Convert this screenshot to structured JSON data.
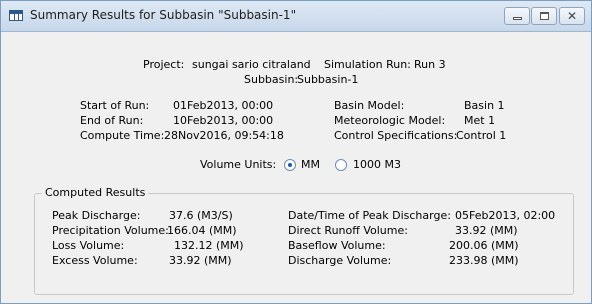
{
  "window": {
    "title": "Summary Results for Subbasin \"Subbasin-1\"",
    "icon": "table-window-icon"
  },
  "header": {
    "project_label": "Project:",
    "project_value": "sungai sario citraland",
    "run_label": "Simulation Run:",
    "run_value": "Run 3",
    "subbasin_label": "Subbasin:",
    "subbasin_value": "Subbasin-1"
  },
  "run_info": {
    "start_label": "Start of Run:",
    "start_value": "01Feb2013, 00:00",
    "end_label": "End of Run:",
    "end_value": "10Feb2013, 00:00",
    "compute_label": "Compute Time:",
    "compute_value": "28Nov2016, 09:54:18",
    "basin_label": "Basin Model:",
    "basin_value": "Basin 1",
    "met_label": "Meteorologic Model:",
    "met_value": "Met 1",
    "control_label": "Control Specifications:",
    "control_value": "Control 1"
  },
  "volume_units": {
    "label": "Volume Units:",
    "options": [
      "MM",
      "1000 M3"
    ],
    "selected": "MM"
  },
  "computed_results": {
    "title": "Computed Results",
    "left": [
      {
        "label": "Peak Discharge:",
        "value": "37.6 (M3/S)"
      },
      {
        "label": "Precipitation Volume:",
        "value": "166.04 (MM)"
      },
      {
        "label": "Loss Volume:",
        "value": "132.12 (MM)"
      },
      {
        "label": "Excess Volume:",
        "value": "33.92 (MM)"
      }
    ],
    "right": [
      {
        "label": "Date/Time of Peak Discharge:",
        "value": "05Feb2013, 02:00"
      },
      {
        "label": "Direct Runoff Volume:",
        "value": "33.92 (MM)"
      },
      {
        "label": "Baseflow Volume:",
        "value": "200.06 (MM)"
      },
      {
        "label": "Discharge Volume:",
        "value": "233.98 (MM)"
      }
    ]
  }
}
